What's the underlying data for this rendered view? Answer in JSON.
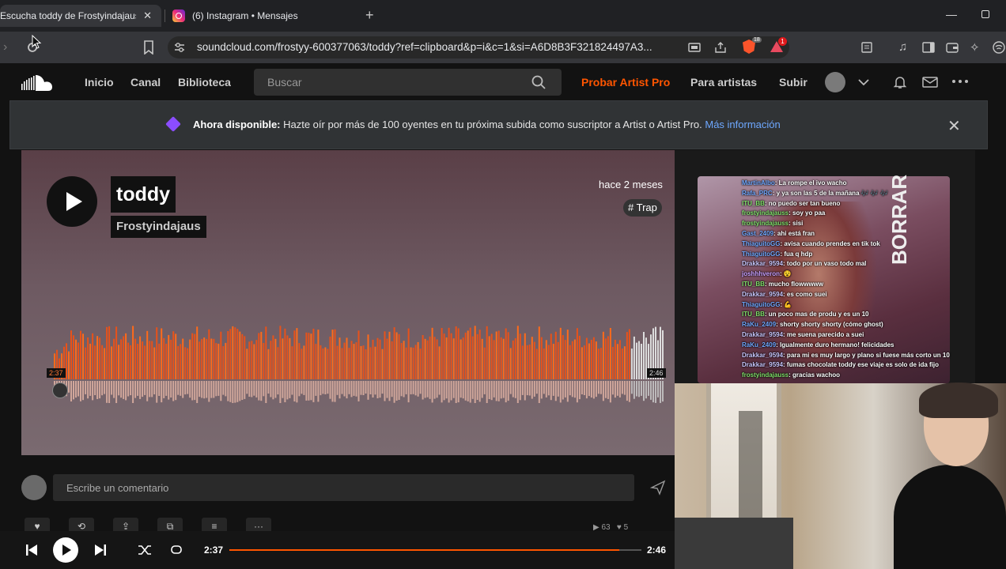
{
  "browser": {
    "tabs": [
      {
        "title": "Escucha toddy de Frostyindajaus",
        "close": "✕"
      },
      {
        "title": "(6) Instagram • Mensajes"
      }
    ],
    "new_tab": "+",
    "url": "soundcloud.com/frostyy-600377063/toddy?ref=clipboard&p=i&c=1&si=A6D8B3F321824497A3...",
    "brave_badge": "18",
    "rewards_badge": "1"
  },
  "header": {
    "nav": [
      "Inicio",
      "Canal",
      "Biblioteca"
    ],
    "search_placeholder": "Buscar",
    "try_pro": "Probar Artist Pro",
    "for_artists": "Para artistas",
    "upload": "Subir"
  },
  "banner": {
    "bold": "Ahora disponible:",
    "text": " Hazte oír por más de 100 oyentes en tu próxima subida como suscriptor a Artist o Artist Pro. ",
    "link": "Más información",
    "close": "✕"
  },
  "track": {
    "title": "toddy",
    "artist": "Frostyindajaus",
    "posted": "hace 2 meses",
    "tag": "# Trap",
    "time_current": "2:37",
    "time_total": "2:46",
    "progress": 0.946
  },
  "artwork": {
    "label": "BORRAR",
    "chat": [
      {
        "user": "MartinAlbo",
        "msg": ": La rompe el ivo wacho",
        "color": "#6fa8ff"
      },
      {
        "user": "Rafa_PRC",
        "msg": ": y ya son las 5 de la mañana 🎶 🎶 🎶",
        "color": "#6fa8ff"
      },
      {
        "user": "ITU_BB",
        "msg": ": no puedo ser tan bueno",
        "color": "#7fe06a"
      },
      {
        "user": "frostyindajauss",
        "msg": ": soy yo paa",
        "color": "#7fe06a"
      },
      {
        "user": "frostyindajauss",
        "msg": ": sisi",
        "color": "#7fe06a"
      },
      {
        "user": "Gast_2409",
        "msg": ": ahi está fran",
        "color": "#6fa8ff"
      },
      {
        "user": "ThiaguitoGG",
        "msg": ": avisa cuando prendes en tik tok",
        "color": "#6fa8ff"
      },
      {
        "user": "ThiaguitoGG",
        "msg": ": fua q hdp",
        "color": "#6fa8ff"
      },
      {
        "user": "Drakkar_9594",
        "msg": ": todo por un vaso todo mal",
        "color": "#c8c8ff"
      },
      {
        "user": "joshhhveron",
        "msg": ": 😵",
        "color": "#c8a0ff"
      },
      {
        "user": "ITU_BB",
        "msg": ": mucho flowwwww",
        "color": "#7fe06a"
      },
      {
        "user": "Drakkar_9594",
        "msg": ": es como suei",
        "color": "#c8c8ff"
      },
      {
        "user": "ThiaguitoGG",
        "msg": ": 💪",
        "color": "#6fa8ff"
      },
      {
        "user": "ITU_BB",
        "msg": ": un poco mas de produ y es un 10",
        "color": "#7fe06a"
      },
      {
        "user": "RaKu_2409",
        "msg": ": shorty shorty shorty          (cómo ghost)",
        "color": "#6fa8ff"
      },
      {
        "user": "Drakkar_9594",
        "msg": ": me suena parecido a suei",
        "color": "#c8c8ff"
      },
      {
        "user": "RaKu_2409",
        "msg": ": Igualmente duro hermano! felicidades",
        "color": "#6fa8ff"
      },
      {
        "user": "Drakkar_9594",
        "msg": ": para mi es muy largo y plano si fuese más corto un 10",
        "color": "#c8c8ff"
      },
      {
        "user": "Drakkar_9594",
        "msg": ": fumas chocolate toddy ese viaje es solo de ida fijo",
        "color": "#c8c8ff"
      },
      {
        "user": "frostyindajauss",
        "msg": ": gracias wachoo",
        "color": "#7fe06a"
      }
    ]
  },
  "comment": {
    "placeholder": "Escribe un comentario"
  },
  "actions": {
    "more": "···"
  },
  "stats": {
    "plays": "63",
    "likes": "5"
  },
  "colors": {
    "accent": "#ff5500",
    "link": "#6ea8ff"
  }
}
